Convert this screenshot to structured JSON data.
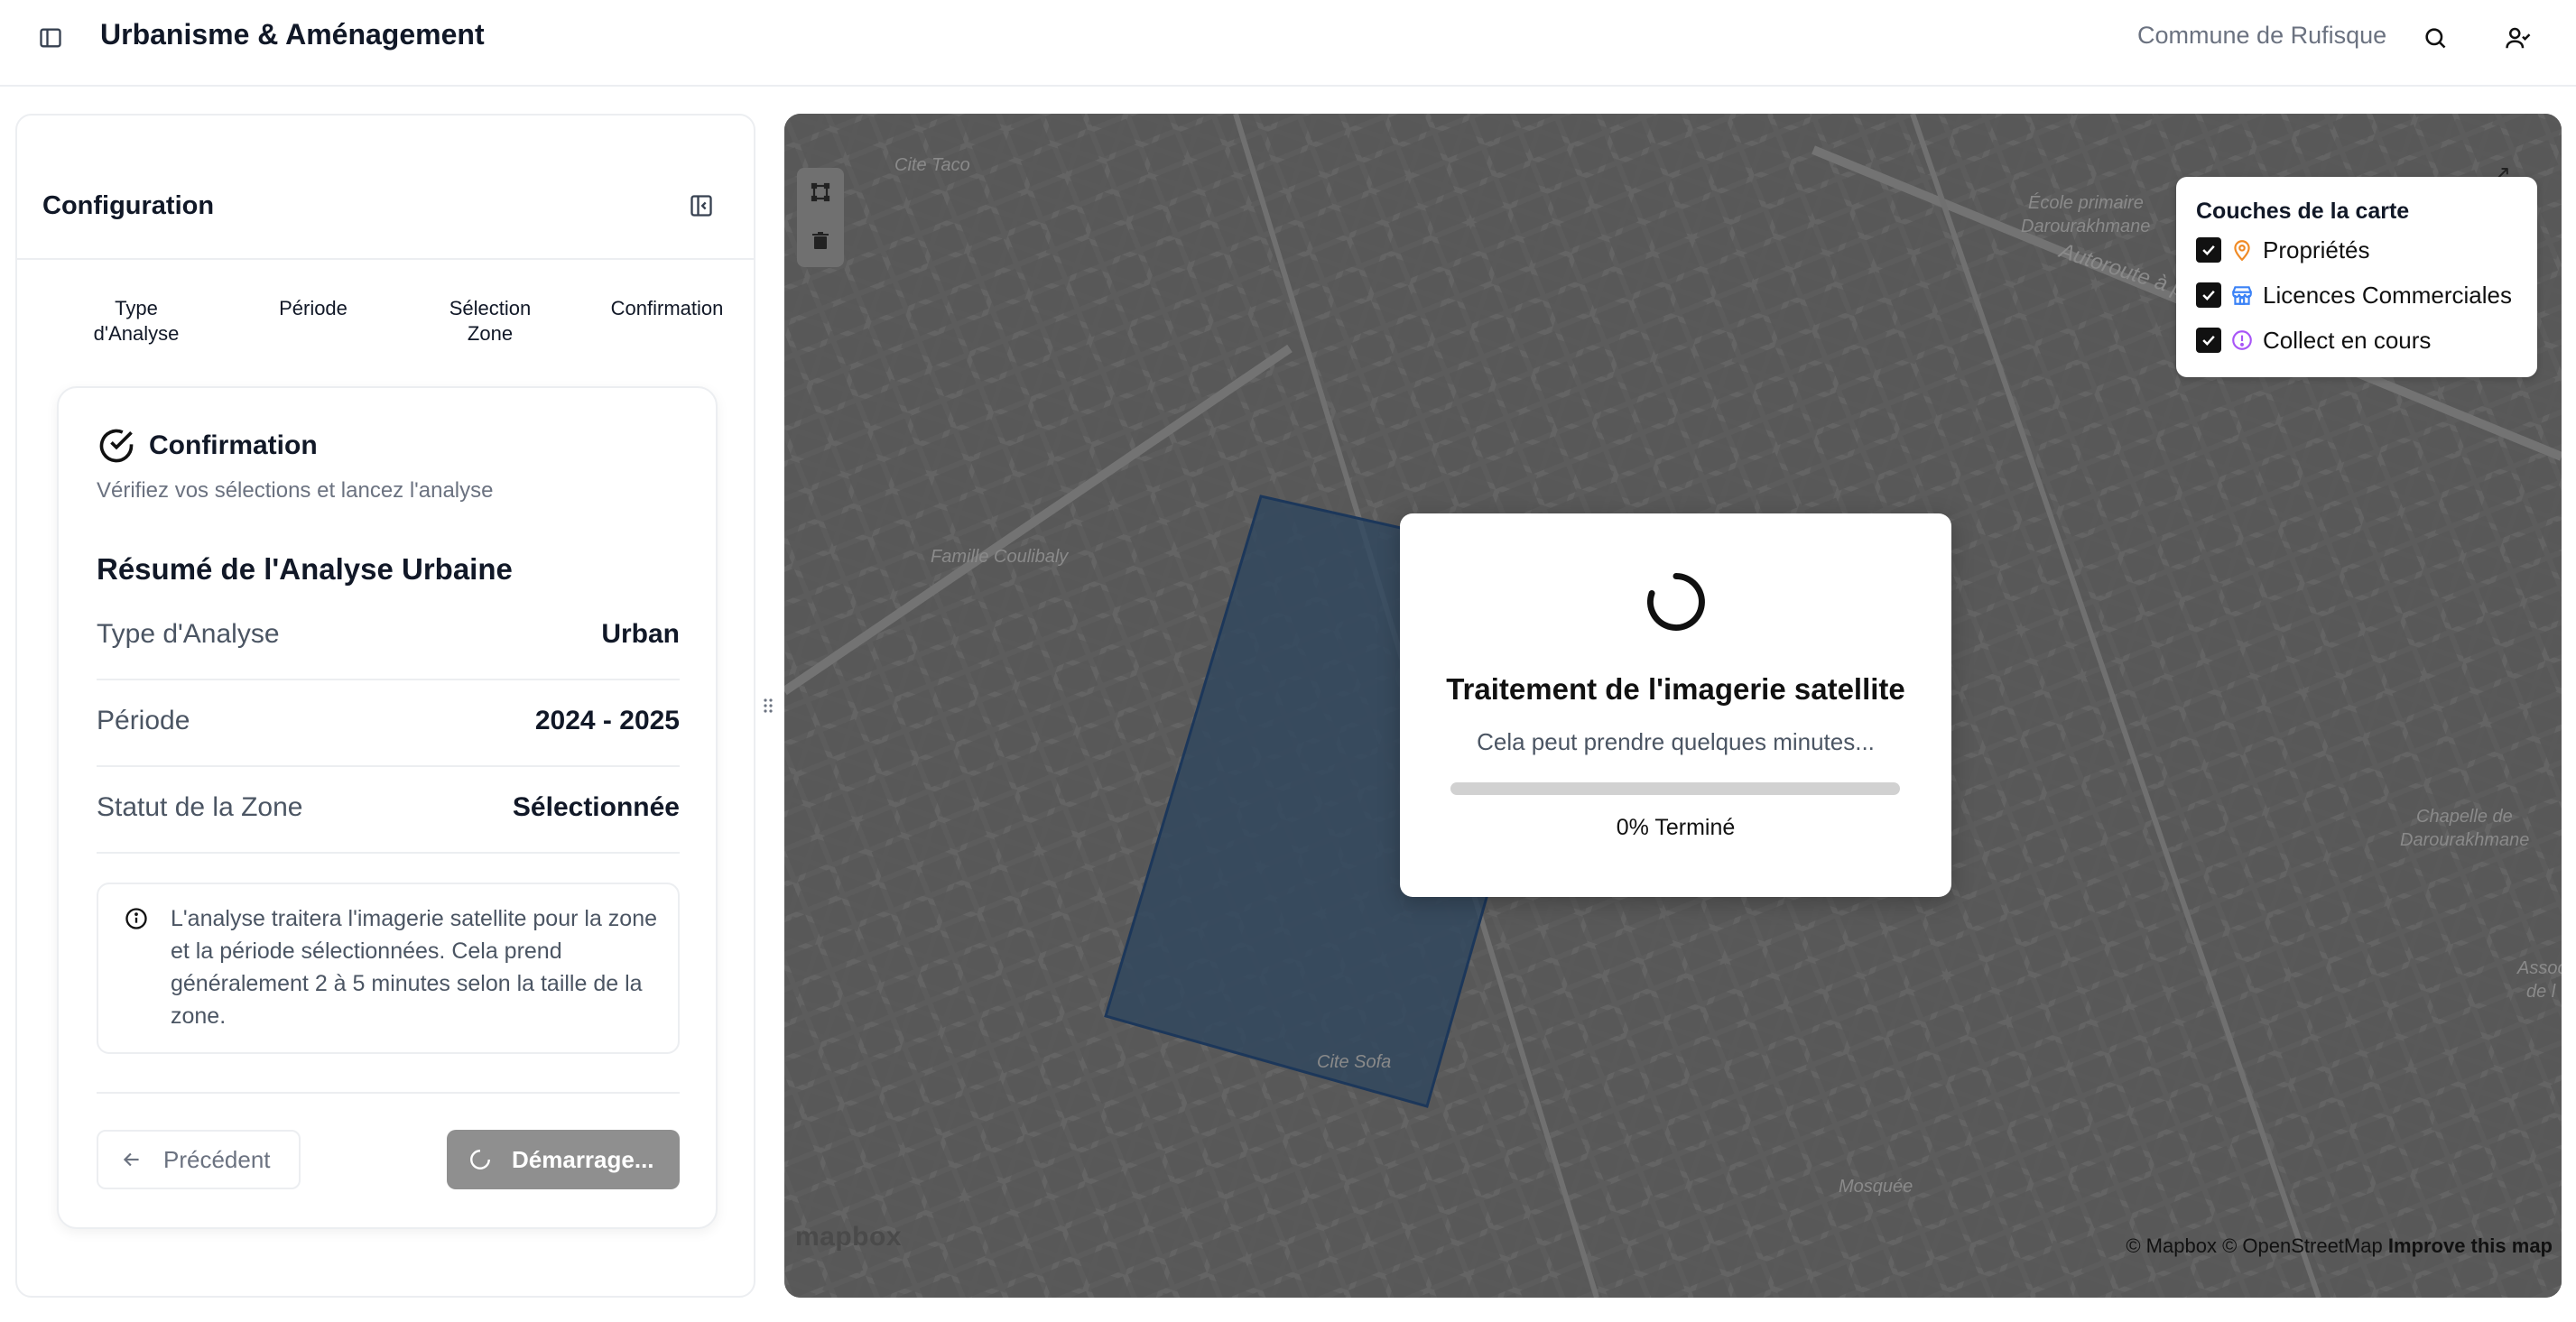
{
  "header": {
    "title": "Urbanisme & Aménagement",
    "commune": "Commune de Rufisque"
  },
  "panel": {
    "title": "Configuration",
    "steps": [
      {
        "line1": "Type",
        "line2": "d'Analyse"
      },
      {
        "line1": "Période",
        "line2": ""
      },
      {
        "line1": "Sélection",
        "line2": "Zone"
      },
      {
        "line1": "Confirmation",
        "line2": ""
      }
    ],
    "card": {
      "title": "Confirmation",
      "subtitle": "Vérifiez vos sélections et lancez l'analyse",
      "summary_title": "Résumé de l'Analyse Urbaine",
      "rows": [
        {
          "key": "Type d'Analyse",
          "value": "Urban"
        },
        {
          "key": "Période",
          "value": "2024 - 2025"
        },
        {
          "key": "Statut de la Zone",
          "value": "Sélectionnée"
        }
      ],
      "info": "L'analyse traitera l'imagerie satellite pour la zone et la période sélectionnées. Cela prend généralement 2 à 5 minutes selon la taille de la zone.",
      "prev_label": "Précédent",
      "start_label": "Démarrage..."
    }
  },
  "map": {
    "labels": [
      "Cite Taco",
      "École primaire",
      "Darourakhmane",
      "Autoroute à p",
      "Famille Coulibaly",
      "Chapelle de",
      "Darourakhmane",
      "Cite Sofa",
      "Mosquée",
      "Assoc",
      "de l"
    ],
    "attribution": {
      "mapbox": "© Mapbox",
      "osm": "© OpenStreetMap",
      "improve": "Improve this map"
    },
    "logo": "mapbox",
    "layers": {
      "title": "Couches de la carte",
      "items": [
        {
          "label": "Propriétés",
          "icon": "pin-icon",
          "color": "#f08a24"
        },
        {
          "label": "Licences Commerciales",
          "icon": "store-icon",
          "color": "#3b82f6"
        },
        {
          "label": "Collect en cours",
          "icon": "alert-circle-icon",
          "color": "#a855f7"
        }
      ]
    }
  },
  "modal": {
    "title": "Traitement de l'imagerie satellite",
    "subtitle": "Cela peut prendre quelques minutes...",
    "progress_fraction": 0,
    "progress_label": "0% Terminé"
  }
}
